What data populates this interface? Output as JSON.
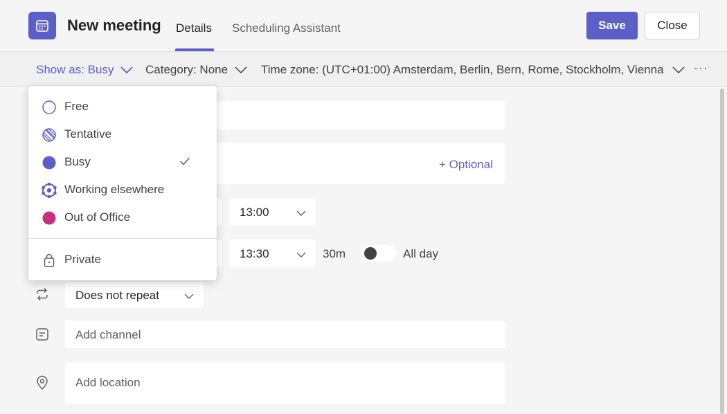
{
  "header": {
    "title": "New meeting",
    "tabs": [
      {
        "label": "Details",
        "active": true
      },
      {
        "label": "Scheduling Assistant",
        "active": false
      }
    ],
    "save_label": "Save",
    "close_label": "Close"
  },
  "toolbar": {
    "show_as": "Show as: Busy",
    "category": "Category: None",
    "time_zone": "Time zone: (UTC+01:00) Amsterdam, Berlin, Bern, Rome, Stockholm, Vienna",
    "more": "···"
  },
  "form": {
    "optional_label": "+ Optional",
    "start_time": "13:00",
    "end_time": "13:30",
    "duration": "30m",
    "all_day_label": "All day",
    "all_day_on": false,
    "repeat": "Does not repeat",
    "channel_placeholder": "Add channel",
    "location_placeholder": "Add location"
  },
  "show_as_menu": {
    "items": [
      {
        "label": "Free",
        "icon": "circle-outline-icon"
      },
      {
        "label": "Tentative",
        "icon": "hatched-circle-icon"
      },
      {
        "label": "Busy",
        "icon": "filled-circle-icon",
        "selected": true
      },
      {
        "label": "Working elsewhere",
        "icon": "dotted-circle-icon"
      },
      {
        "label": "Out of Office",
        "icon": "filled-circle-icon"
      }
    ],
    "private_label": "Private"
  },
  "colors": {
    "accent": "#5b5fc7",
    "busy": "#5b5fc7",
    "out_of_office": "#c4317f"
  }
}
